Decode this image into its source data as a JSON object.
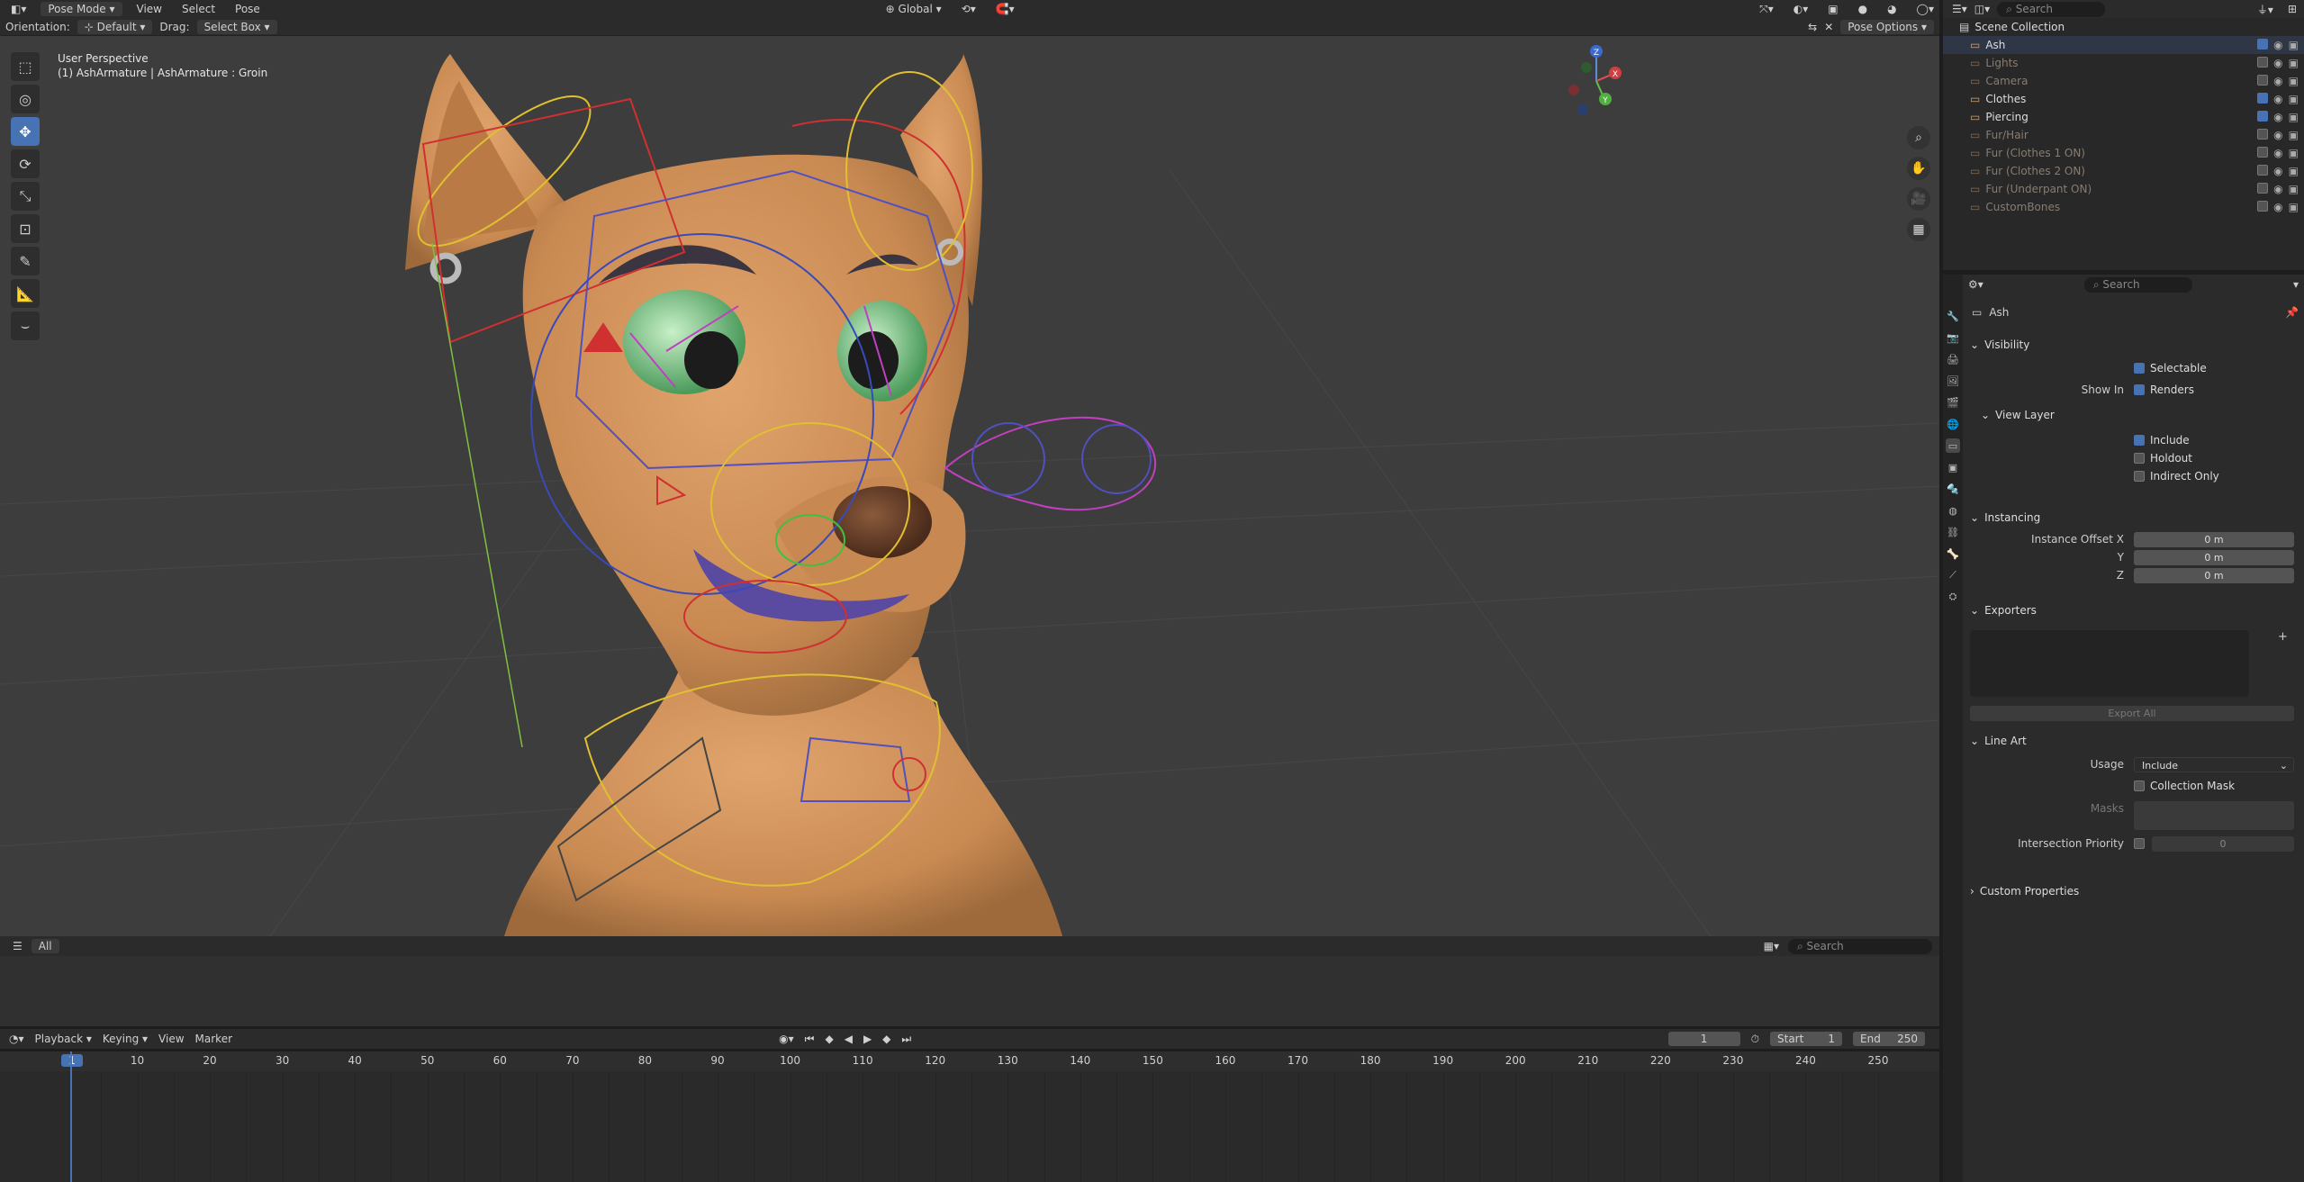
{
  "header": {
    "mode": "Pose Mode",
    "menus": [
      "View",
      "Select",
      "Pose"
    ],
    "transform_orientation": "Global",
    "search_placeholder": "Search"
  },
  "tool_header": {
    "orientation_label": "Orientation:",
    "orientation_value": "Default",
    "drag_label": "Drag:",
    "drag_value": "Select Box",
    "pose_options": "Pose Options"
  },
  "viewport": {
    "view_name": "User Perspective",
    "context": "(1) AshArmature | AshArmature : Groin",
    "gizmo_axes": [
      "X",
      "Y",
      "Z"
    ],
    "background": "#3d3d3d",
    "skin_color": "#c98a52"
  },
  "viewport_footer": {
    "filter_label": "All",
    "search_placeholder": "Search"
  },
  "timeline": {
    "menus": [
      "Playback",
      "Keying",
      "View",
      "Marker"
    ],
    "current_frame": "1",
    "start_label": "Start",
    "start": "1",
    "end_label": "End",
    "end": "250",
    "ruler": [
      "1",
      "10",
      "20",
      "30",
      "40",
      "50",
      "60",
      "70",
      "80",
      "90",
      "100",
      "110",
      "120",
      "130",
      "140",
      "150",
      "160",
      "170",
      "180",
      "190",
      "200",
      "210",
      "220",
      "230",
      "240",
      "250"
    ]
  },
  "outliner": {
    "search_placeholder": "Search",
    "root": "Scene Collection",
    "items": [
      {
        "name": "Ash",
        "enabled": true,
        "selected": true
      },
      {
        "name": "Lights",
        "enabled": false
      },
      {
        "name": "Camera",
        "enabled": false
      },
      {
        "name": "Clothes",
        "enabled": true
      },
      {
        "name": "Piercing",
        "enabled": true
      },
      {
        "name": "Fur/Hair",
        "enabled": false
      },
      {
        "name": "Fur (Clothes 1 ON)",
        "enabled": false
      },
      {
        "name": "Fur (Clothes 2 ON)",
        "enabled": false
      },
      {
        "name": "Fur (Underpant ON)",
        "enabled": false
      },
      {
        "name": "CustomBones",
        "enabled": false
      }
    ]
  },
  "properties": {
    "search_placeholder": "Search",
    "collection_name": "Ash",
    "visibility": {
      "title": "Visibility",
      "selectable": "Selectable",
      "show_in": "Show In",
      "renders": "Renders",
      "view_layer": "View Layer",
      "include": "Include",
      "holdout": "Holdout",
      "indirect_only": "Indirect Only"
    },
    "instancing": {
      "title": "Instancing",
      "offset_x_label": "Instance Offset X",
      "y_label": "Y",
      "z_label": "Z",
      "x": "0 m",
      "y": "0 m",
      "z": "0 m"
    },
    "exporters": {
      "title": "Exporters",
      "export_all": "Export All"
    },
    "line_art": {
      "title": "Line Art",
      "usage_label": "Usage",
      "usage": "Include",
      "collection_mask": "Collection Mask",
      "masks": "Masks",
      "intersection_priority": "Intersection Priority",
      "priority_value": "0"
    },
    "custom_properties": "Custom Properties"
  }
}
